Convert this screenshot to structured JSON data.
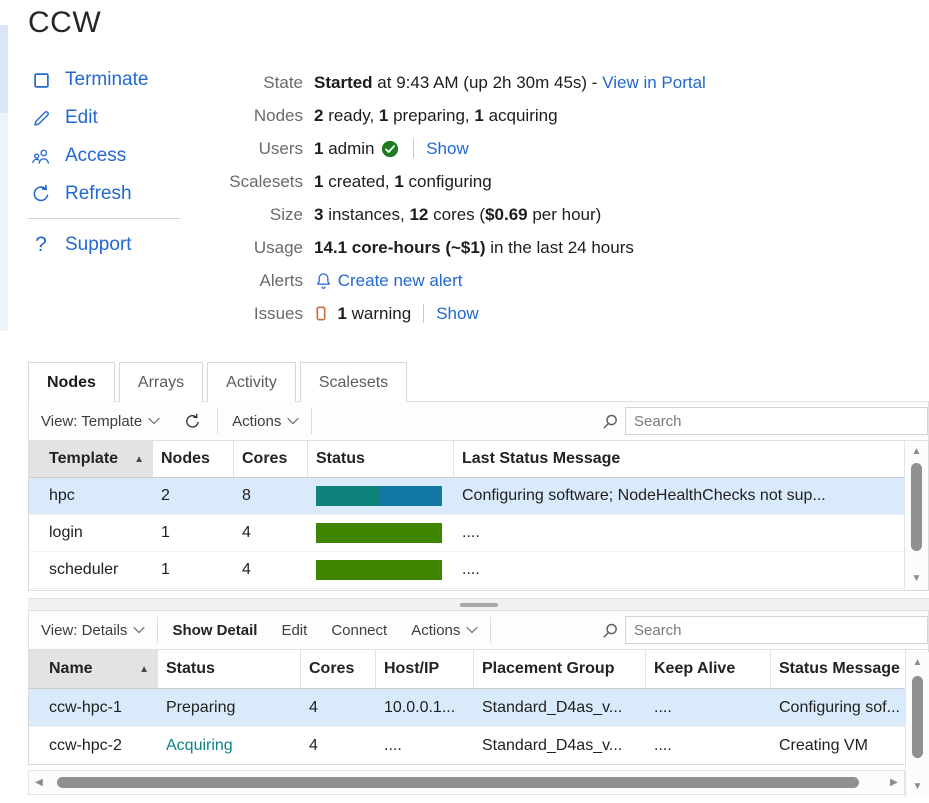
{
  "page": {
    "title": "CCW"
  },
  "colors": {
    "link_blue": "#2368d0",
    "text": "#1f1f1f",
    "selected_row": "#d9eafb",
    "status_green": "#3f8500",
    "status_teal": "#0d837c",
    "status_blue": "#1478a6",
    "acquiring_teal": "#10838a",
    "check_green": "#1f7d1f",
    "warning_orange": "#c6703c"
  },
  "action_menu": {
    "items": [
      {
        "id": "terminate",
        "label": "Terminate",
        "icon": "stop-square-icon"
      },
      {
        "id": "edit",
        "label": "Edit",
        "icon": "pencil-icon"
      },
      {
        "id": "access",
        "label": "Access",
        "icon": "people-icon"
      },
      {
        "id": "refresh",
        "label": "Refresh",
        "icon": "refresh-icon"
      },
      {
        "id": "support",
        "label": "Support",
        "icon": "question-icon"
      }
    ],
    "divider_after": "refresh"
  },
  "info": {
    "rows": [
      {
        "label": "State",
        "segments": [
          {
            "t": "Started",
            "b": true
          },
          {
            "t": " at 9:43 AM (up 2h 30m 45s) - "
          },
          {
            "t": "View in Portal",
            "link": true
          }
        ]
      },
      {
        "label": "Nodes",
        "segments": [
          {
            "t": "2",
            "b": true
          },
          {
            "t": " ready, "
          },
          {
            "t": "1",
            "b": true
          },
          {
            "t": " preparing, "
          },
          {
            "t": "1",
            "b": true
          },
          {
            "t": " acquiring"
          }
        ]
      },
      {
        "label": "Users",
        "segments": [
          {
            "t": "1",
            "b": true
          },
          {
            "t": " admin "
          },
          {
            "icon": "check-circle-icon"
          },
          {
            "divider": true
          },
          {
            "t": "Show",
            "link": true
          }
        ]
      },
      {
        "label": "Scalesets",
        "segments": [
          {
            "t": "1",
            "b": true
          },
          {
            "t": " created, "
          },
          {
            "t": "1",
            "b": true
          },
          {
            "t": " configuring"
          }
        ]
      },
      {
        "label": "Size",
        "segments": [
          {
            "t": "3",
            "b": true
          },
          {
            "t": " instances, "
          },
          {
            "t": "12",
            "b": true
          },
          {
            "t": " cores ("
          },
          {
            "t": "$0.69",
            "b": true
          },
          {
            "t": " per hour)"
          }
        ]
      },
      {
        "label": "Usage",
        "segments": [
          {
            "t": "14.1 core-hours (~$1)",
            "b": true
          },
          {
            "t": " in the last 24 hours"
          }
        ]
      },
      {
        "label": "Alerts",
        "segments": [
          {
            "icon": "bell-icon",
            "link": true
          },
          {
            "t": " Create new alert",
            "link": true
          }
        ]
      },
      {
        "label": "Issues",
        "segments": [
          {
            "icon": "warning-icon"
          },
          {
            "t": "  "
          },
          {
            "t": "1",
            "b": true
          },
          {
            "t": " warning"
          },
          {
            "divider": true
          },
          {
            "t": "Show",
            "link": true
          }
        ]
      }
    ]
  },
  "tabs": [
    {
      "label": "Nodes",
      "active": true
    },
    {
      "label": "Arrays",
      "active": false
    },
    {
      "label": "Activity",
      "active": false
    },
    {
      "label": "Scalesets",
      "active": false
    }
  ],
  "toolbar1": {
    "view_label": "View: Template",
    "actions_label": "Actions",
    "search_placeholder": "Search"
  },
  "table1": {
    "columns": [
      {
        "label": "Template",
        "sorted": "asc"
      },
      {
        "label": "Nodes"
      },
      {
        "label": "Cores"
      },
      {
        "label": "Status"
      },
      {
        "label": "Last Status Message"
      }
    ],
    "rows": [
      {
        "template": "hpc",
        "nodes": "2",
        "cores": "8",
        "bar": [
          {
            "color": "status_teal",
            "pct": 50
          },
          {
            "color": "status_blue",
            "pct": 50
          }
        ],
        "message": "Configuring software; NodeHealthChecks not sup...",
        "selected": true
      },
      {
        "template": "login",
        "nodes": "1",
        "cores": "4",
        "bar": [
          {
            "color": "status_green",
            "pct": 100
          }
        ],
        "message": "....",
        "selected": false
      },
      {
        "template": "scheduler",
        "nodes": "1",
        "cores": "4",
        "bar": [
          {
            "color": "status_green",
            "pct": 100
          }
        ],
        "message": "....",
        "selected": false
      }
    ]
  },
  "toolbar2": {
    "view_label": "View: Details",
    "buttons": [
      {
        "id": "show-detail",
        "label": "Show Detail",
        "bold": true
      },
      {
        "id": "edit",
        "label": "Edit",
        "bold": false
      },
      {
        "id": "connect",
        "label": "Connect",
        "bold": false
      }
    ],
    "actions_label": "Actions",
    "search_placeholder": "Search"
  },
  "table2": {
    "columns": [
      {
        "label": "Name",
        "sorted": "asc"
      },
      {
        "label": "Status"
      },
      {
        "label": "Cores"
      },
      {
        "label": "Host/IP"
      },
      {
        "label": "Placement Group"
      },
      {
        "label": "Keep Alive"
      },
      {
        "label": "Status Message"
      }
    ],
    "rows": [
      {
        "name": "ccw-hpc-1",
        "status": "Preparing",
        "status_teal": false,
        "cores": "4",
        "host": "10.0.0.1...",
        "placement": "Standard_D4as_v...",
        "keep_alive": "....",
        "message": "Configuring sof...",
        "selected": true
      },
      {
        "name": "ccw-hpc-2",
        "status": "Acquiring",
        "status_teal": true,
        "cores": "4",
        "host": "....",
        "placement": "Standard_D4as_v...",
        "keep_alive": "....",
        "message": "Creating VM",
        "selected": false
      }
    ]
  },
  "glyphs": {
    "sort_asc": "▲",
    "up": "▲",
    "down": "▼",
    "left": "◀",
    "right": "▶"
  }
}
